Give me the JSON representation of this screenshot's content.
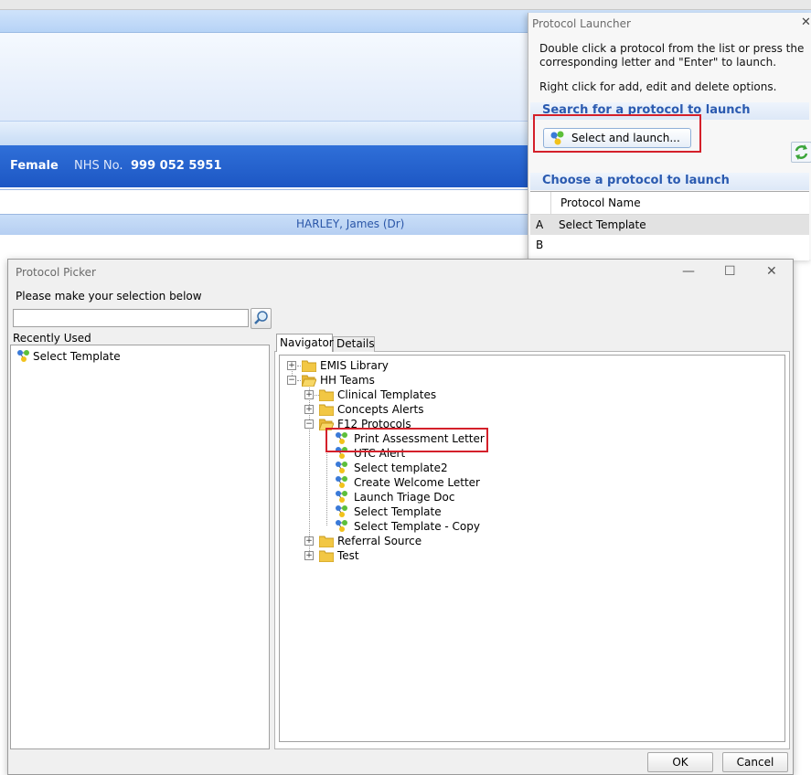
{
  "background_window": {
    "patient_bar": {
      "gender": "Female",
      "nhs_label": "NHS No.",
      "nhs_value": "999 052 5951"
    },
    "doctor": "HARLEY, James (Dr)"
  },
  "launcher": {
    "title": "Protocol Launcher",
    "close_glyph": "✕",
    "instructions": "Double click a protocol from the list or press the corresponding letter and \"Enter\" to launch.",
    "instructions2": "Right click for add, edit and delete options.",
    "search_header": "Search for a protocol to launch",
    "select_launch_label": "Select and launch...",
    "choose_header": "Choose a protocol to launch",
    "grid": {
      "column": "Protocol Name",
      "rows": [
        {
          "key": "A",
          "name": "Select Template"
        },
        {
          "key": "B",
          "name": ""
        }
      ]
    }
  },
  "picker": {
    "title": "Protocol Picker",
    "window_buttons": {
      "minimize": "—",
      "maximize": "☐",
      "close": "✕"
    },
    "prompt": "Please make your selection below",
    "search_value": "",
    "recently_used_label": "Recently Used",
    "recent_items": [
      "Select Template"
    ],
    "tabs": [
      "Navigator",
      "Details"
    ],
    "tree": {
      "emis_library": "EMIS Library",
      "hh_teams": "HH Teams",
      "clinical_templates": "Clinical Templates",
      "concepts_alerts": "Concepts Alerts",
      "f12_protocols": "F12 Protocols",
      "f12_children": [
        "Print Assessment Letter",
        "UTC Alert",
        "Select template2",
        "Create Welcome Letter",
        "Launch Triage Doc",
        "Select Template",
        "Select Template - Copy"
      ],
      "referral_source": "Referral Source",
      "test": "Test"
    },
    "ok_label": "OK",
    "cancel_label": "Cancel"
  },
  "colors": {
    "highlight_red": "#d4202a",
    "patient_bar_blue": "#2463cf",
    "section_header_text": "#2a5ab0"
  }
}
